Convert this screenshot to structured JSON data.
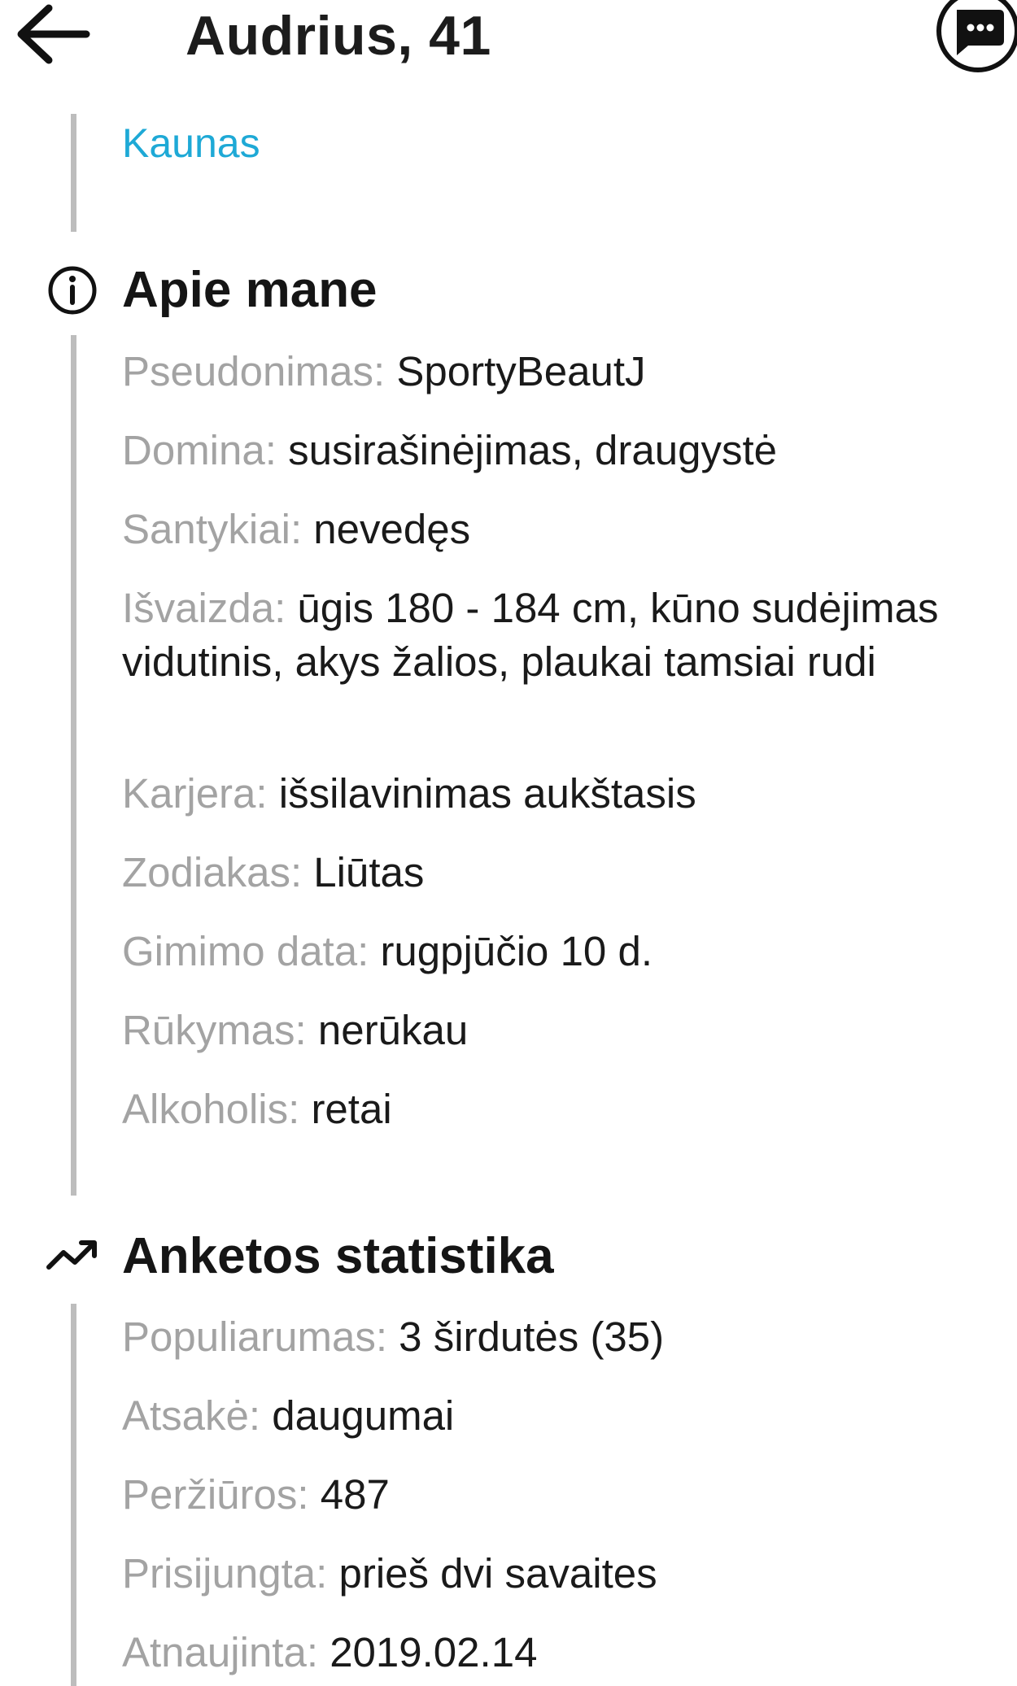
{
  "header": {
    "title": "Audrius, 41",
    "back_icon": "arrow-left-icon",
    "chat_icon": "chat-bubble-icon"
  },
  "location": {
    "city": "Kaunas",
    "color": "#1ea9d6"
  },
  "about": {
    "title": "Apie mane",
    "icon": "info-icon",
    "rows": [
      {
        "label": "Pseudonimas:",
        "value": "SportyBeautJ"
      },
      {
        "label": "Domina:",
        "value": "susirašinėjimas, draugystė"
      },
      {
        "label": "Santykiai:",
        "value": "nevedęs"
      },
      {
        "label": "Išvaizda:",
        "value": "ūgis 180 - 184 cm, kūno sudėjimas vidutinis, akys žalios, plaukai tamsiai rudi"
      },
      {
        "label": "Karjera:",
        "value": "išsilavinimas aukštasis"
      },
      {
        "label": "Zodiakas:",
        "value": "Liūtas"
      },
      {
        "label": "Gimimo data:",
        "value": "rugpjūčio 10 d."
      },
      {
        "label": "Rūkymas:",
        "value": "nerūkau"
      },
      {
        "label": "Alkoholis:",
        "value": "retai"
      }
    ]
  },
  "stats": {
    "title": "Anketos statistika",
    "icon": "trending-up-icon",
    "rows": [
      {
        "label": "Populiarumas:",
        "value": "3 širdutės (35)"
      },
      {
        "label": "Atsakė:",
        "value": "daugumai"
      },
      {
        "label": "Peržiūros:",
        "value": "487"
      },
      {
        "label": "Prisijungta:",
        "value": "prieš dvi savaites"
      },
      {
        "label": "Atnaujinta:",
        "value": "2019.02.14"
      }
    ]
  }
}
